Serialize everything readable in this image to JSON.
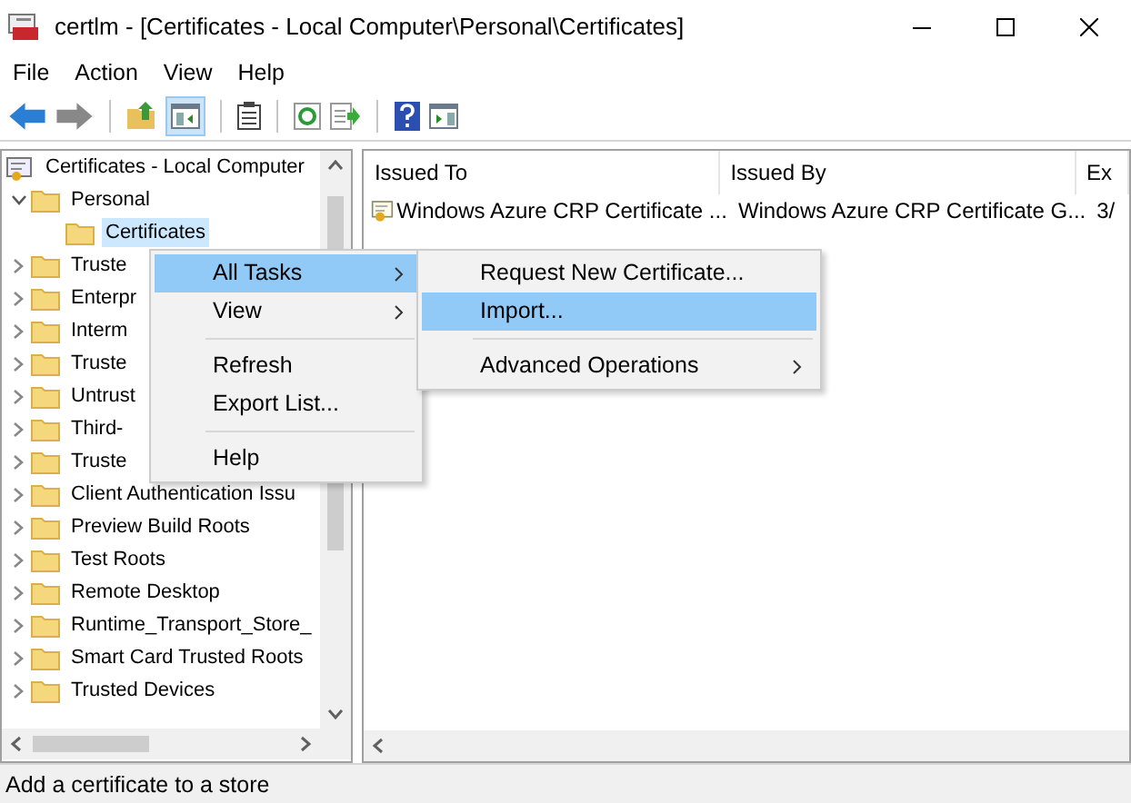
{
  "window": {
    "title": "certlm - [Certificates - Local Computer\\Personal\\Certificates]"
  },
  "menu_bar": [
    "File",
    "Action",
    "View",
    "Help"
  ],
  "tree": {
    "label": "Certificates - Local Computer",
    "selected": false,
    "children": [
      {
        "label": "Personal",
        "expanded": true,
        "selected": false,
        "children": [
          {
            "label": "Certificates",
            "selected": true
          }
        ]
      },
      {
        "label": "Truste",
        "expanded": false,
        "selected": false
      },
      {
        "label": "Enterpr",
        "expanded": false,
        "selected": false
      },
      {
        "label": "Interm",
        "expanded": false,
        "selected": false
      },
      {
        "label": "Truste",
        "expanded": false,
        "selected": false
      },
      {
        "label": "Untrust",
        "expanded": false,
        "selected": false
      },
      {
        "label": "Third-",
        "expanded": false,
        "selected": false
      },
      {
        "label": "Truste",
        "expanded": false,
        "selected": false
      },
      {
        "label": "Client Authentication Issu",
        "expanded": false,
        "selected": false
      },
      {
        "label": "Preview Build Roots",
        "expanded": false,
        "selected": false
      },
      {
        "label": "Test Roots",
        "expanded": false,
        "selected": false
      },
      {
        "label": "Remote Desktop",
        "expanded": false,
        "selected": false
      },
      {
        "label": "Runtime_Transport_Store_",
        "expanded": false,
        "selected": false
      },
      {
        "label": "Smart Card Trusted Roots",
        "expanded": false,
        "selected": false
      },
      {
        "label": "Trusted Devices",
        "expanded": false,
        "selected": false
      }
    ]
  },
  "list": {
    "columns": [
      "Issued To",
      "Issued By",
      "Ex"
    ],
    "rows": [
      [
        "Windows Azure CRP Certificate ...",
        "Windows Azure CRP Certificate G...",
        "3/"
      ]
    ]
  },
  "context_menu": {
    "items": [
      {
        "kind": "item",
        "label": "All Tasks",
        "submenu": true,
        "selected": true
      },
      {
        "kind": "item",
        "label": "View",
        "submenu": true,
        "selected": false
      },
      {
        "kind": "separator"
      },
      {
        "kind": "item",
        "label": "Refresh",
        "submenu": false,
        "selected": false
      },
      {
        "kind": "item",
        "label": "Export List...",
        "submenu": false,
        "selected": false
      },
      {
        "kind": "separator"
      },
      {
        "kind": "item",
        "label": "Help",
        "submenu": false,
        "selected": false
      }
    ]
  },
  "submenu": {
    "items": [
      {
        "kind": "item",
        "label": "Request New Certificate...",
        "submenu": false,
        "selected": false
      },
      {
        "kind": "item",
        "label": "Import...",
        "submenu": false,
        "selected": true
      },
      {
        "kind": "separator"
      },
      {
        "kind": "item",
        "label": "Advanced Operations",
        "submenu": true,
        "selected": false
      }
    ]
  },
  "status_bar": "Add a certificate to a store"
}
